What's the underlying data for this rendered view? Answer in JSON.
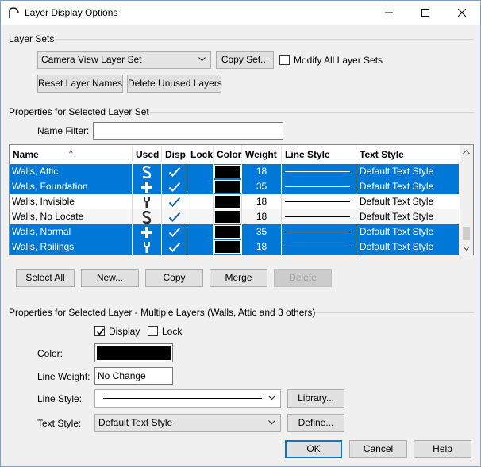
{
  "window": {
    "title": "Layer Display Options"
  },
  "layer_sets": {
    "group_title": "Layer Sets",
    "selected_set": "Camera View Layer Set",
    "copy_set": "Copy Set...",
    "modify_all": {
      "label": "Modify All Layer Sets",
      "checked": false
    },
    "reset_names": "Reset Layer Names",
    "delete_unused": "Delete Unused Layers"
  },
  "properties_set": {
    "group_title": "Properties for Selected Layer Set",
    "name_filter_label": "Name Filter:",
    "name_filter_value": ""
  },
  "table": {
    "columns": [
      "Name",
      "Used",
      "Disp",
      "Lock",
      "Color",
      "Weight",
      "Line Style",
      "Text Style"
    ],
    "rows": [
      {
        "name": "Walls,  Attic",
        "used": "S-icon",
        "disp": true,
        "lock": false,
        "color": "#000000",
        "weight": "18",
        "text_style": "Default Text Style",
        "selected": true
      },
      {
        "name": "Walls,  Foundation",
        "used": "plus-icon",
        "disp": true,
        "lock": false,
        "color": "#000000",
        "weight": "35",
        "text_style": "Default Text Style",
        "selected": true
      },
      {
        "name": "Walls,  Invisible",
        "used": "wrench-icon",
        "disp": true,
        "lock": false,
        "color": "#000000",
        "weight": "18",
        "text_style": "Default Text Style",
        "selected": false
      },
      {
        "name": "Walls,  No Locate",
        "used": "S-icon",
        "disp": true,
        "lock": false,
        "color": "#000000",
        "weight": "18",
        "text_style": "Default Text Style",
        "selected": false
      },
      {
        "name": "Walls,  Normal",
        "used": "plus-icon",
        "disp": true,
        "lock": false,
        "color": "#000000",
        "weight": "35",
        "text_style": "Default Text Style",
        "selected": true
      },
      {
        "name": "Walls,  Railings",
        "used": "wrench-icon",
        "disp": true,
        "lock": false,
        "color": "#000000",
        "weight": "18",
        "text_style": "Default Text Style",
        "selected": true
      }
    ]
  },
  "table_buttons": {
    "select_all": "Select All",
    "new": "New...",
    "copy": "Copy",
    "merge": "Merge",
    "delete": "Delete"
  },
  "properties_layer": {
    "group_title": "Properties for Selected Layer - Multiple Layers (Walls,  Attic and 3 others)",
    "display": {
      "label": "Display",
      "checked": true
    },
    "lock": {
      "label": "Lock",
      "checked": false
    },
    "color_label": "Color:",
    "color_value": "#000000",
    "line_weight_label": "Line Weight:",
    "line_weight_value": "No Change",
    "line_style_label": "Line Style:",
    "library": "Library...",
    "text_style_label": "Text Style:",
    "text_style_value": "Default Text Style",
    "define": "Define..."
  },
  "footer": {
    "ok": "OK",
    "cancel": "Cancel",
    "help": "Help"
  },
  "colors": {
    "selection": "#0078d7",
    "default_button_border": "#0078d7"
  }
}
